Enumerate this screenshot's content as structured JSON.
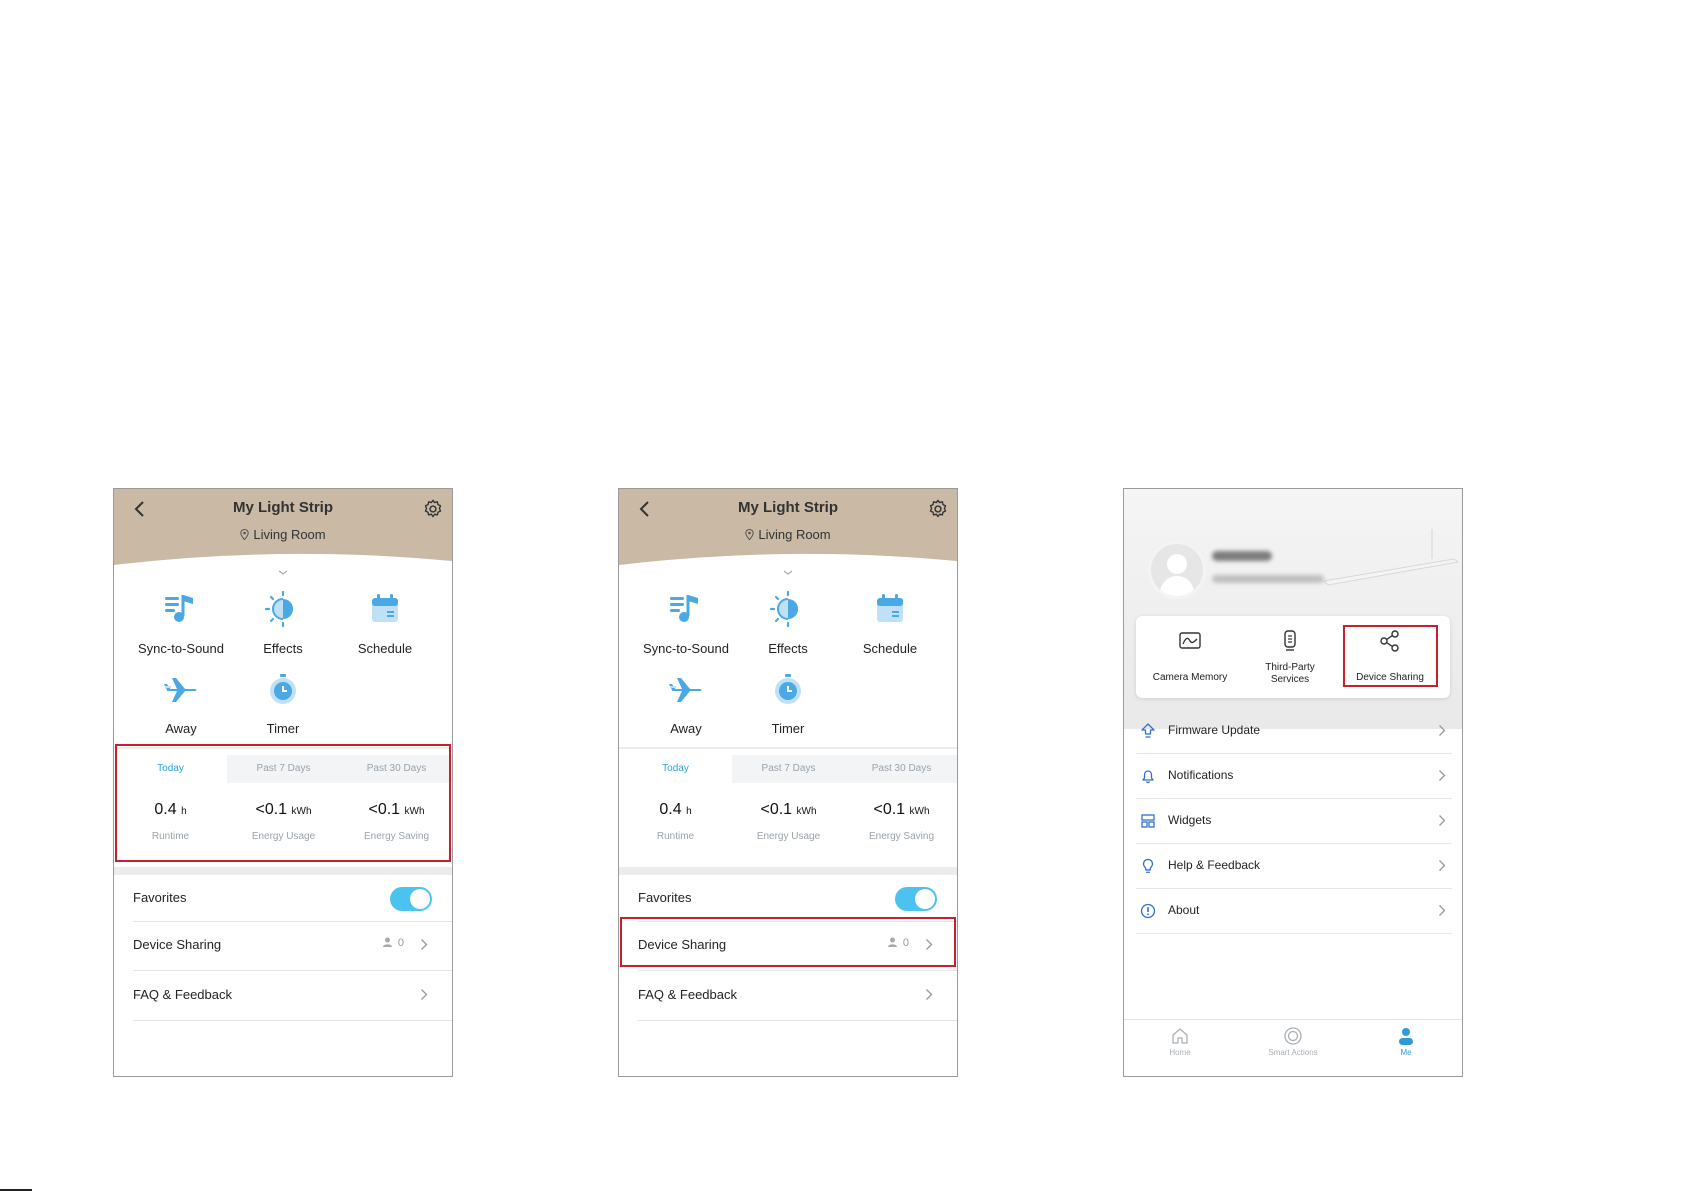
{
  "device_screen": {
    "title": "My Light Strip",
    "location": "Living Room",
    "features": [
      {
        "label": "Sync-to-Sound",
        "icon": "music-note-icon"
      },
      {
        "label": "Effects",
        "icon": "half-sun-icon"
      },
      {
        "label": "Schedule",
        "icon": "calendar-icon"
      },
      {
        "label": "Away",
        "icon": "airplane-icon"
      },
      {
        "label": "Timer",
        "icon": "timer-icon"
      }
    ],
    "tabs": [
      "Today",
      "Past 7 Days",
      "Past 30 Days"
    ],
    "active_tab": "Today",
    "stats": [
      {
        "value": "0.4",
        "unit": "h",
        "caption": "Runtime"
      },
      {
        "value": "<0.1",
        "unit": "kWh",
        "caption": "Energy Usage"
      },
      {
        "value": "<0.1",
        "unit": "kWh",
        "caption": "Energy Saving"
      }
    ],
    "favorites_label": "Favorites",
    "favorites_on": true,
    "device_sharing_label": "Device Sharing",
    "device_sharing_count": "0",
    "faq_label": "FAQ & Feedback"
  },
  "me_screen": {
    "quick_actions": [
      {
        "label": "Camera Memory",
        "icon": "camera-memory-icon"
      },
      {
        "label": "Third-Party\nServices",
        "icon": "third-party-services-icon"
      },
      {
        "label": "Device Sharing",
        "icon": "share-icon"
      }
    ],
    "menu": [
      {
        "label": "Firmware Update",
        "icon": "firmware-update-icon"
      },
      {
        "label": "Notifications",
        "icon": "bell-icon"
      },
      {
        "label": "Widgets",
        "icon": "widgets-icon"
      },
      {
        "label": "Help & Feedback",
        "icon": "lightbulb-icon"
      },
      {
        "label": "About",
        "icon": "info-icon"
      }
    ],
    "nav": [
      {
        "label": "Home",
        "icon": "home-icon",
        "active": false
      },
      {
        "label": "Smart Actions",
        "icon": "smart-actions-icon",
        "active": false
      },
      {
        "label": "Me",
        "icon": "person-icon",
        "active": true
      }
    ]
  },
  "colors": {
    "header_tan": "#c9b9a5",
    "accent_blue": "#29a3e6",
    "icon_blue": "#4aa8e4",
    "highlight_red": "#c81f2e",
    "toggle_on": "#4cc3ef"
  }
}
